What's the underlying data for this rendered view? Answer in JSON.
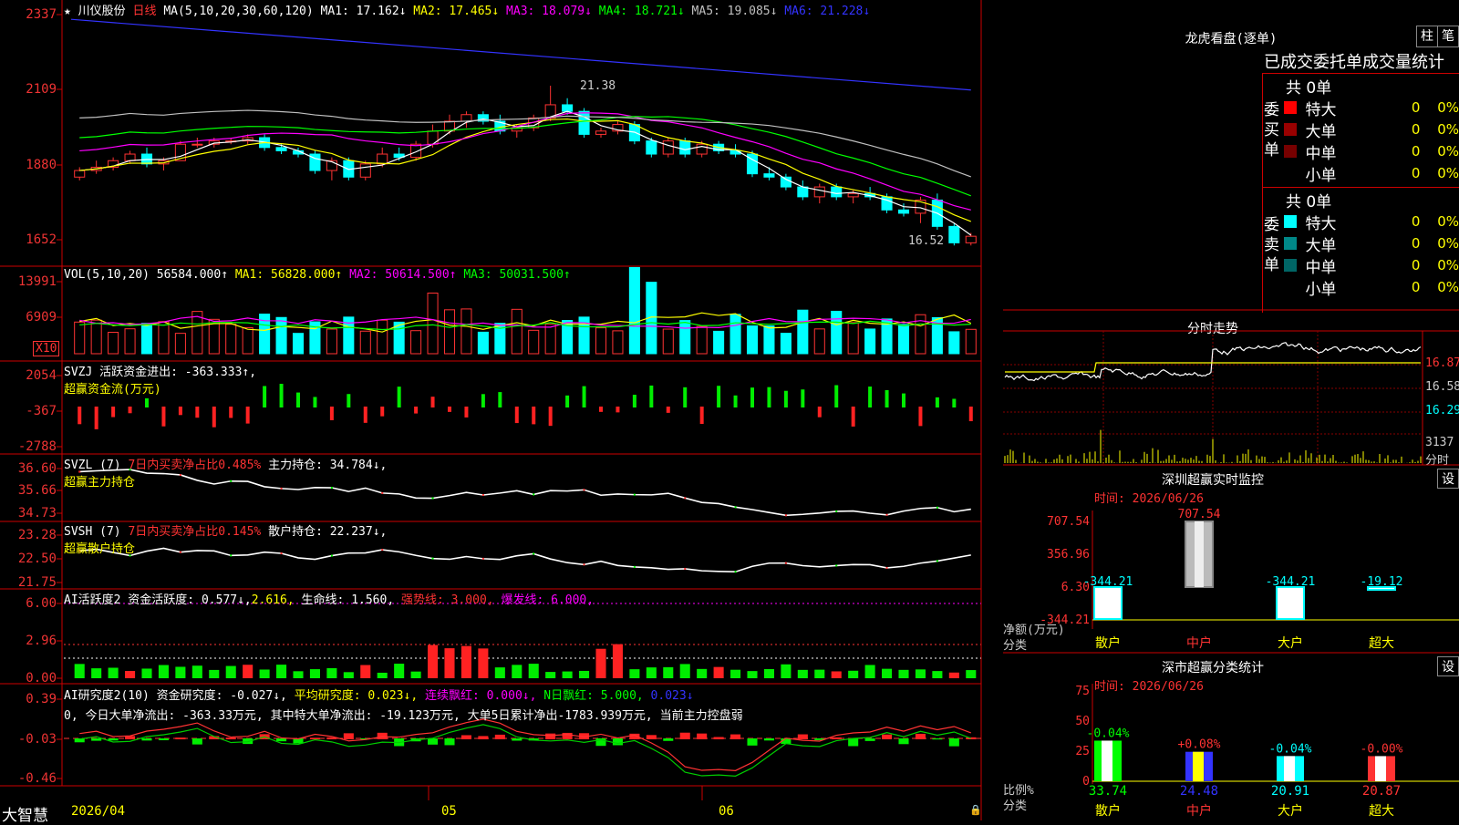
{
  "stock": {
    "name": "川仪股份",
    "period": "日线"
  },
  "main_chart": {
    "ma_header": "MA(5,10,20,30,60,120)",
    "ma": [
      {
        "label": "MA1:",
        "value": "17.162",
        "arrow": "↓",
        "color": "#ffffff"
      },
      {
        "label": "MA2:",
        "value": "17.465",
        "arrow": "↓",
        "color": "#ffff00"
      },
      {
        "label": "MA3:",
        "value": "18.079",
        "arrow": "↓",
        "color": "#ff00ff"
      },
      {
        "label": "MA4:",
        "value": "18.721",
        "arrow": "↓",
        "color": "#00ff00"
      },
      {
        "label": "MA5:",
        "value": "19.085",
        "arrow": "↓",
        "color": "#c0c0c0"
      },
      {
        "label": "MA6:",
        "value": "21.228",
        "arrow": "↓",
        "color": "#3333ff"
      }
    ],
    "y_ticks": [
      "2337",
      "2109",
      "1880",
      "1652"
    ],
    "high_label": "21.38",
    "low_label": "16.52"
  },
  "vol_chart": {
    "header": "VOL(5,10,20)",
    "value": "56584.000↑",
    "ma": [
      {
        "label": "MA1:",
        "value": "56828.000↑",
        "color": "#ffff00"
      },
      {
        "label": "MA2:",
        "value": "50614.500↑",
        "color": "#ff00ff"
      },
      {
        "label": "MA3:",
        "value": "50031.500↑",
        "color": "#00ff00"
      }
    ],
    "y_ticks": [
      "13991",
      "6909"
    ],
    "unit": "X10"
  },
  "svzj": {
    "line1": "SVZJ  活跃资金进出: -363.333↑,",
    "line2": "超赢资金流(万元)",
    "y_ticks": [
      "2054",
      "-367",
      "-2788"
    ]
  },
  "svzl": {
    "line1a": "SVZL (7) ",
    "line1b": "7日内买卖净占比0.485%",
    "line1c": " 主力持仓: 34.784↓,",
    "line2": "超赢主力持仓",
    "y_ticks": [
      "36.60",
      "35.66",
      "34.73"
    ]
  },
  "svsh": {
    "line1a": "SVSH (7) ",
    "line1b": "7日内买卖净占比0.145%",
    "line1c": " 散户持仓: 22.237↓,",
    "line2": "超赢散户持仓",
    "y_ticks": [
      "23.28",
      "22.50",
      "21.75"
    ]
  },
  "ai1": {
    "a": "AI活跃度2 资金活跃度: 0.577↓,",
    "b": "2.616,",
    "c": " 生命线: 1.560,",
    "d": " 强势线: 3.000,",
    "e": " 爆发线: 6.000,",
    "y_ticks": [
      "6.00",
      "2.96",
      "0.00"
    ]
  },
  "ai2": {
    "a": "AI研究度2(10) 资金研究度: -0.027↓,",
    "b": " 平均研究度: 0.023↓,",
    "c": " 连续飘红: 0.000↓,",
    "d": " N日飘红: 5.000,",
    "e": " 0.023↓",
    "summary": "0, 今日大单净流出: -363.33万元, 其中特大单净流出: -19.123万元, 大单5日累计净出-1783.939万元, 当前主力控盘弱",
    "y_ticks": [
      "0.39",
      "-0.03",
      "-0.46"
    ]
  },
  "x_axis": {
    "brand": "大智慧",
    "labels": [
      "2026/04",
      "05",
      "06"
    ]
  },
  "right": {
    "dragon": {
      "title": "龙虎看盘(逐单)",
      "btn1": "柱",
      "btn2": "笔",
      "subtitle": "已成交委托单成交量统计",
      "buy": {
        "side": "委买单",
        "total": "共 0单",
        "rows": [
          {
            "name": "特大",
            "count": "0",
            "pct": "0%",
            "color": "#ff0000"
          },
          {
            "name": "大单",
            "count": "0",
            "pct": "0%",
            "color": "#990000"
          },
          {
            "name": "中单",
            "count": "0",
            "pct": "0%",
            "color": "#770000"
          },
          {
            "name": "小单",
            "count": "0",
            "pct": "0%",
            "color": "#000000"
          }
        ]
      },
      "sell": {
        "side": "委卖单",
        "total": "共 0单",
        "rows": [
          {
            "name": "特大",
            "count": "0",
            "pct": "0%",
            "color": "#00ffff"
          },
          {
            "name": "大单",
            "count": "0",
            "pct": "0%",
            "color": "#008888"
          },
          {
            "name": "中单",
            "count": "0",
            "pct": "0%",
            "color": "#006666"
          },
          {
            "name": "小单",
            "count": "0",
            "pct": "0%",
            "color": "#000000"
          }
        ]
      }
    },
    "intraday": {
      "title": "分时走势",
      "y_ticks": [
        "16.87",
        "16.58",
        "16.29"
      ],
      "vol_tick": "3137",
      "vol_unit": "分时"
    },
    "sz_monitor": {
      "title": "深圳超赢实时监控",
      "btn": "设",
      "time": "时间: 2026/06/26",
      "y_ticks": [
        "707.54",
        "356.96",
        "6.30",
        "-344.21"
      ],
      "ylabel1": "净额(万元)",
      "ylabel2": "分类",
      "bars": [
        {
          "cat": "散户",
          "label": "-344.21",
          "value": -344.21
        },
        {
          "cat": "中户",
          "label": "707.54",
          "value": 707.54
        },
        {
          "cat": "大户",
          "label": "-344.21",
          "value": -344.21
        },
        {
          "cat": "超大",
          "label": "-19.12",
          "value": -19.12
        }
      ]
    },
    "sz_class": {
      "title": "深市超赢分类统计",
      "btn": "设",
      "time": "时间: 2026/06/26",
      "y_ticks": [
        "75",
        "50",
        "25",
        "0"
      ],
      "ylabel1": "比例%",
      "ylabel2": "分类",
      "bars": [
        {
          "cat": "散户",
          "pct_label": "-0.04%",
          "value": 33.74,
          "value_label": "33.74"
        },
        {
          "cat": "中户",
          "pct_label": "+0.08%",
          "value": 24.48,
          "value_label": "24.48"
        },
        {
          "cat": "大户",
          "pct_label": "-0.04%",
          "value": 20.91,
          "value_label": "20.91"
        },
        {
          "cat": "超大",
          "pct_label": "-0.00%",
          "value": 20.87,
          "value_label": "20.87"
        }
      ]
    }
  },
  "chart_data": {
    "type": "candlestick",
    "title": "川仪股份 日线",
    "ylim": [
      16.52,
      23.37
    ],
    "ohlc": [
      [
        18.6,
        18.9,
        18.5,
        18.8
      ],
      [
        18.8,
        19.1,
        18.7,
        18.9
      ],
      [
        18.9,
        19.2,
        18.8,
        19.1
      ],
      [
        19.1,
        19.4,
        19.0,
        19.3
      ],
      [
        19.3,
        19.5,
        18.9,
        19.0
      ],
      [
        19.0,
        19.2,
        18.8,
        19.1
      ],
      [
        19.1,
        19.7,
        19.1,
        19.6
      ],
      [
        19.6,
        19.8,
        19.5,
        19.6
      ],
      [
        19.6,
        19.8,
        19.5,
        19.7
      ],
      [
        19.7,
        19.8,
        19.6,
        19.7
      ],
      [
        19.7,
        19.9,
        19.6,
        19.8
      ],
      [
        19.8,
        19.9,
        19.4,
        19.5
      ],
      [
        19.5,
        19.6,
        19.3,
        19.4
      ],
      [
        19.4,
        19.5,
        19.2,
        19.3
      ],
      [
        19.3,
        19.4,
        18.7,
        18.8
      ],
      [
        18.8,
        19.2,
        18.5,
        19.1
      ],
      [
        19.1,
        19.2,
        18.5,
        18.6
      ],
      [
        18.6,
        19.1,
        18.5,
        19.0
      ],
      [
        19.0,
        19.5,
        18.9,
        19.3
      ],
      [
        19.3,
        19.5,
        19.1,
        19.2
      ],
      [
        19.2,
        19.7,
        19.1,
        19.6
      ],
      [
        19.6,
        20.2,
        19.5,
        20.0
      ],
      [
        20.0,
        20.5,
        19.9,
        20.3
      ],
      [
        20.3,
        20.6,
        20.1,
        20.5
      ],
      [
        20.5,
        20.6,
        20.2,
        20.3
      ],
      [
        20.3,
        20.5,
        19.9,
        20.0
      ],
      [
        20.0,
        20.2,
        19.8,
        20.1
      ],
      [
        20.1,
        20.5,
        20.0,
        20.4
      ],
      [
        20.4,
        21.38,
        20.3,
        20.8
      ],
      [
        20.8,
        21.0,
        20.5,
        20.6
      ],
      [
        20.6,
        20.7,
        19.8,
        19.9
      ],
      [
        19.9,
        20.1,
        19.8,
        20.0
      ],
      [
        20.0,
        20.3,
        19.9,
        20.2
      ],
      [
        20.2,
        20.3,
        19.6,
        19.7
      ],
      [
        19.7,
        19.8,
        19.2,
        19.3
      ],
      [
        19.3,
        19.8,
        19.2,
        19.7
      ],
      [
        19.7,
        19.8,
        19.2,
        19.3
      ],
      [
        19.3,
        19.7,
        19.2,
        19.6
      ],
      [
        19.6,
        19.7,
        19.3,
        19.4
      ],
      [
        19.4,
        19.6,
        19.2,
        19.3
      ],
      [
        19.3,
        19.4,
        18.6,
        18.7
      ],
      [
        18.7,
        18.9,
        18.5,
        18.6
      ],
      [
        18.6,
        18.7,
        18.2,
        18.3
      ],
      [
        18.3,
        18.5,
        17.9,
        18.0
      ],
      [
        18.0,
        18.4,
        17.8,
        18.3
      ],
      [
        18.3,
        18.4,
        17.9,
        18.0
      ],
      [
        18.0,
        18.2,
        17.8,
        18.1
      ],
      [
        18.1,
        18.3,
        17.9,
        18.0
      ],
      [
        18.0,
        18.1,
        17.5,
        17.6
      ],
      [
        17.6,
        17.8,
        17.4,
        17.5
      ],
      [
        17.5,
        18.0,
        17.2,
        17.9
      ],
      [
        17.9,
        18.1,
        17.0,
        17.1
      ],
      [
        17.1,
        17.2,
        16.52,
        16.6
      ],
      [
        16.6,
        16.9,
        16.52,
        16.8
      ]
    ]
  }
}
